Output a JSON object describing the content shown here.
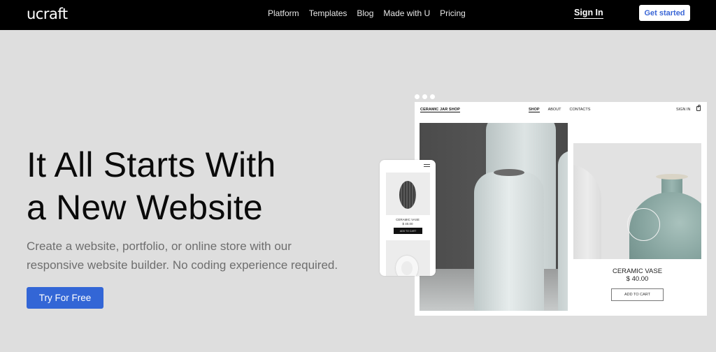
{
  "header": {
    "logo": "ucraft",
    "nav": [
      "Platform",
      "Templates",
      "Blog",
      "Made with U",
      "Pricing"
    ],
    "sign_in": "Sign In",
    "get_started": "Get started"
  },
  "hero": {
    "title_line1": "It All Starts With",
    "title_line2": "a New Website",
    "subtitle_line1": "Create a website, portfolio, or online store with our",
    "subtitle_line2": "responsive website builder. No coding experience required.",
    "cta": "Try For Free"
  },
  "mockup": {
    "brand": "CERAMIC JAR SHOP",
    "nav": [
      "SHOP",
      "ABOUT",
      "CONTACTS"
    ],
    "active_nav": "SHOP",
    "sign_in": "SIGN IN",
    "product_name": "CERAMIC VASE",
    "product_price": "$ 40.00",
    "add_to_cart": "ADD TO CART"
  },
  "phone": {
    "product_name": "CERAMIC VASE",
    "product_price": "$ 40.00",
    "add_to_cart": "ADD TO CART"
  },
  "colors": {
    "accent": "#3366d6",
    "header_bg": "#000000",
    "page_bg": "#dedede"
  }
}
